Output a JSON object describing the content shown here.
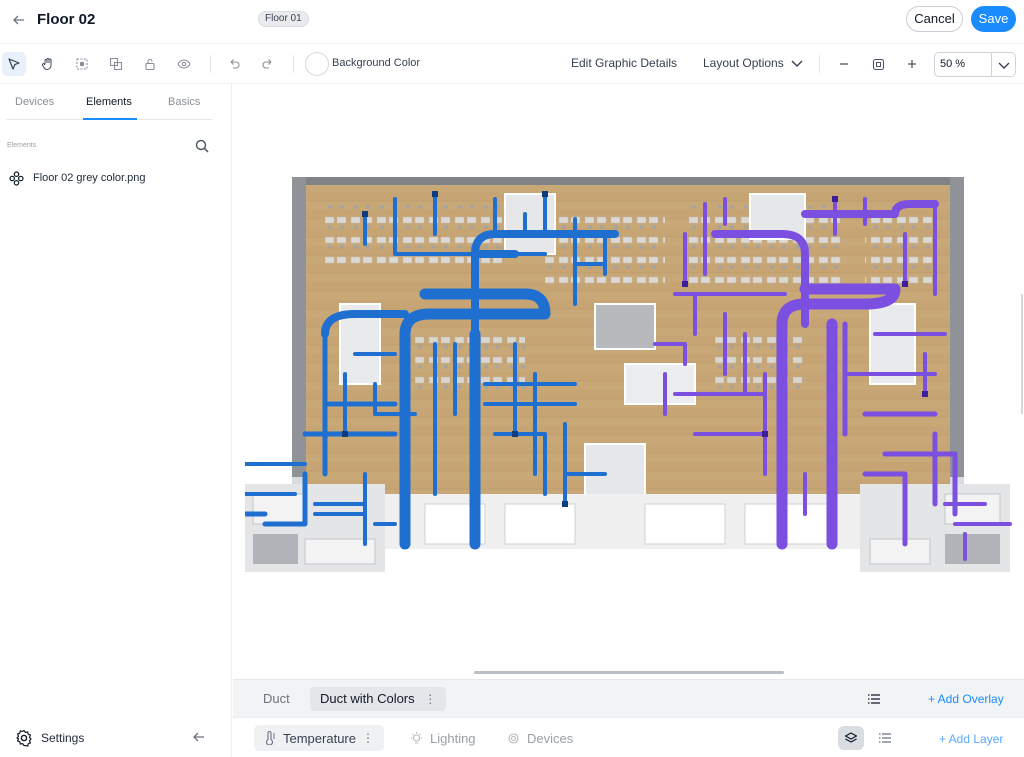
{
  "header": {
    "title": "Floor 02",
    "floor_chip": "Floor 01",
    "cancel_label": "Cancel",
    "save_label": "Save"
  },
  "toolbar": {
    "background_color_label": "Background Color",
    "edit_graphic_details_label": "Edit Graphic Details",
    "layout_options_label": "Layout Options",
    "zoom_value": "50 %"
  },
  "sidebar": {
    "tabs": [
      "Devices",
      "Elements",
      "Basics"
    ],
    "active_tab": "Elements",
    "section_label": "Elements",
    "items": [
      {
        "label": "Floor 02 grey color.png"
      }
    ],
    "settings_label": "Settings"
  },
  "overlays": {
    "tabs": [
      "Duct",
      "Duct with Colors"
    ],
    "active_tab": "Duct with Colors",
    "add_overlay_label": "+ Add Overlay"
  },
  "layers": {
    "tabs": [
      "Temperature",
      "Lighting",
      "Devices"
    ],
    "active_tab": "Temperature",
    "add_layer_label": "+ Add Layer"
  },
  "colors": {
    "accent": "#1a8cff",
    "duct_blue": "#1f6fd1",
    "duct_purple": "#7b4fe0",
    "floor_wood": "#c9a878",
    "wall_grey": "#8f9398"
  }
}
